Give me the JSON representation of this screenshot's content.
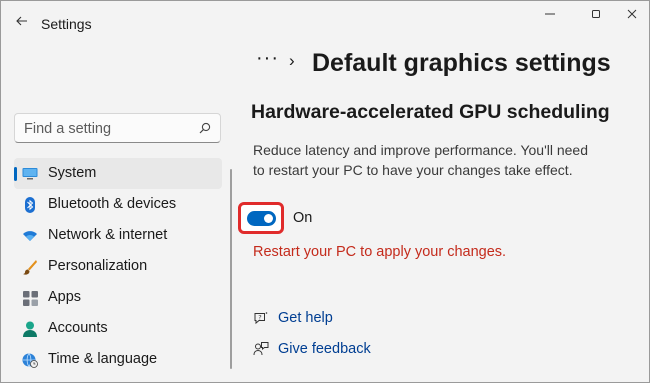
{
  "window": {
    "title": "Settings",
    "back_icon": "arrow-left-icon",
    "controls": [
      "minimize-icon",
      "maximize-icon",
      "close-icon"
    ]
  },
  "sidebar": {
    "search": {
      "placeholder": "Find a setting",
      "icon": "search-icon"
    },
    "items": [
      {
        "label": "System",
        "icon": "monitor-icon",
        "selected": true
      },
      {
        "label": "Bluetooth & devices",
        "icon": "bluetooth-icon"
      },
      {
        "label": "Network & internet",
        "icon": "wifi-icon"
      },
      {
        "label": "Personalization",
        "icon": "brush-icon"
      },
      {
        "label": "Apps",
        "icon": "apps-icon"
      },
      {
        "label": "Accounts",
        "icon": "person-icon"
      },
      {
        "label": "Time & language",
        "icon": "globe-clock-icon"
      }
    ]
  },
  "breadcrumb": {
    "more": "···",
    "separator": "›",
    "title": "Default graphics settings"
  },
  "main": {
    "section_title": "Hardware-accelerated GPU scheduling",
    "description": "Reduce latency and improve performance. You'll need to restart your PC to have your changes take effect.",
    "toggle": {
      "state_label": "On",
      "on": true
    },
    "restart_message": "Restart your PC to apply your changes.",
    "links": [
      {
        "label": "Get help",
        "icon": "help-chat-icon"
      },
      {
        "label": "Give feedback",
        "icon": "feedback-icon"
      }
    ]
  },
  "colors": {
    "accent": "#0067c0",
    "warning_text": "#c42b1c",
    "link": "#003e92",
    "highlight_border": "#e02b2b"
  }
}
